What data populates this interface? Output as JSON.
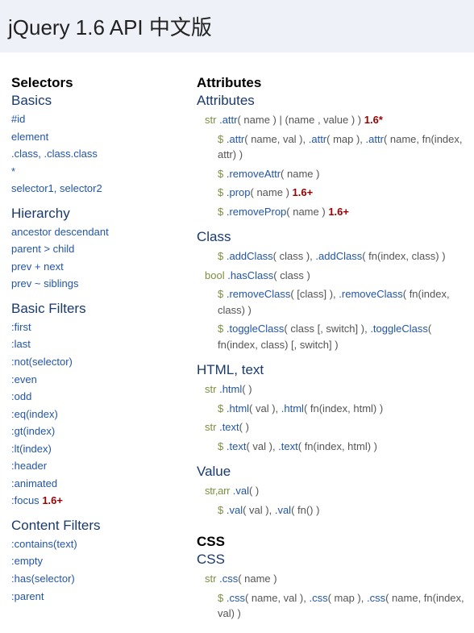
{
  "header": {
    "title": "jQuery 1.6 API 中文版"
  },
  "left": {
    "selectors_title": "Selectors",
    "basics": {
      "title": "Basics",
      "items": [
        "#id",
        "element",
        ".class, .class.class",
        "*",
        "selector1, selector2"
      ]
    },
    "hierarchy": {
      "title": "Hierarchy",
      "items": [
        "ancestor descendant",
        "parent > child",
        "prev + next",
        "prev ~ siblings"
      ]
    },
    "basic_filters": {
      "title": "Basic Filters",
      "items": [
        ":first",
        ":last",
        ":not(selector)",
        ":even",
        ":odd",
        ":eq(index)",
        ":gt(index)",
        ":lt(index)",
        ":header",
        ":animated"
      ],
      "last_item": ":focus",
      "last_badge": "1.6+"
    },
    "content_filters": {
      "title": "Content Filters",
      "items": [
        ":contains(text)",
        ":empty",
        ":has(selector)",
        ":parent"
      ]
    }
  },
  "right": {
    "attributes_title": "Attributes",
    "attr_sub": {
      "title": "Attributes",
      "lines": [
        {
          "ret": "str",
          "parts": [
            {
              "m": ".attr",
              "a": "( name ) | (name , value ) )"
            }
          ],
          "badge": "1.6*",
          "nested": false
        },
        {
          "ret": "$",
          "parts": [
            {
              "m": ".attr",
              "a": "( name, val ), "
            },
            {
              "m": ".attr",
              "a": "( map ), "
            },
            {
              "m": ".attr",
              "a": "( name, fn(index, attr) )"
            }
          ],
          "nested": true
        },
        {
          "ret": "$",
          "parts": [
            {
              "m": ".removeAttr",
              "a": "( name )"
            }
          ],
          "nested": true
        },
        {
          "ret": "$",
          "parts": [
            {
              "m": ".prop",
              "a": "( name )"
            }
          ],
          "badge": "1.6+",
          "nested": true
        },
        {
          "ret": "$",
          "parts": [
            {
              "m": ".removeProp",
              "a": "( name )"
            }
          ],
          "badge": "1.6+",
          "nested": true
        }
      ]
    },
    "class_sub": {
      "title": "Class",
      "lines": [
        {
          "ret": "$",
          "parts": [
            {
              "m": ".addClass",
              "a": "( class ), "
            },
            {
              "m": ".addClass",
              "a": "( fn(index, class) )"
            }
          ],
          "nested": true
        },
        {
          "ret": "bool",
          "parts": [
            {
              "m": ".hasClass",
              "a": "( class )"
            }
          ],
          "nested": false
        },
        {
          "ret": "$",
          "parts": [
            {
              "m": ".removeClass",
              "a": "( [class] ), "
            },
            {
              "m": ".removeClass",
              "a": "( fn(index, class) )"
            }
          ],
          "nested": true
        },
        {
          "ret": "$",
          "parts": [
            {
              "m": ".toggleClass",
              "a": "( class [, switch] ), "
            },
            {
              "m": ".toggleClass",
              "a": "( fn(index, class) [, switch] )"
            }
          ],
          "nested": true
        }
      ]
    },
    "html_sub": {
      "title": "HTML, text",
      "lines": [
        {
          "ret": "str",
          "parts": [
            {
              "m": ".html",
              "a": "( )"
            }
          ],
          "nested": false
        },
        {
          "ret": "$",
          "parts": [
            {
              "m": ".html",
              "a": "( val ), "
            },
            {
              "m": ".html",
              "a": "( fn(index, html) )"
            }
          ],
          "nested": true
        },
        {
          "ret": "str",
          "parts": [
            {
              "m": ".text",
              "a": "( )"
            }
          ],
          "nested": false
        },
        {
          "ret": "$",
          "parts": [
            {
              "m": ".text",
              "a": "( val ), "
            },
            {
              "m": ".text",
              "a": "( fn(index, html) )"
            }
          ],
          "nested": true
        }
      ]
    },
    "value_sub": {
      "title": "Value",
      "lines": [
        {
          "ret": "str,arr",
          "parts": [
            {
              "m": ".val",
              "a": "( )"
            }
          ],
          "nested": false
        },
        {
          "ret": "$",
          "parts": [
            {
              "m": ".val",
              "a": "( val ), "
            },
            {
              "m": ".val",
              "a": "( fn() )"
            }
          ],
          "nested": true
        }
      ]
    },
    "css_title": "CSS",
    "css_sub": {
      "title": "CSS",
      "lines": [
        {
          "ret": "str",
          "parts": [
            {
              "m": ".css",
              "a": "( name )"
            }
          ],
          "nested": false
        },
        {
          "ret": "$",
          "parts": [
            {
              "m": ".css",
              "a": "( name, val ), "
            },
            {
              "m": ".css",
              "a": "( map ), "
            },
            {
              "m": ".css",
              "a": "( name, fn(index, val) )"
            }
          ],
          "nested": true
        }
      ]
    }
  }
}
